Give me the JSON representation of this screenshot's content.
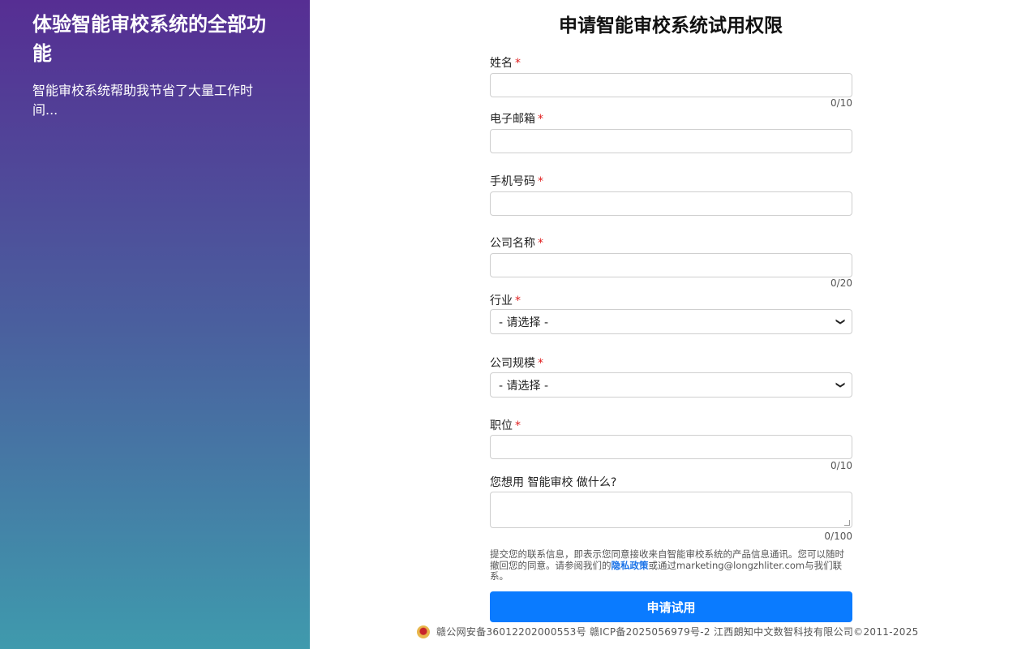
{
  "promo": {
    "title": "体验智能审校系统的全部功能",
    "subtitle": "智能审校系统帮助我节省了大量工作时间..."
  },
  "form": {
    "title": "申请智能审校系统试用权限",
    "required_mark": "*",
    "name": {
      "label": "姓名",
      "value": "",
      "counter": "0/10"
    },
    "email": {
      "label": "电子邮箱",
      "value": ""
    },
    "phone": {
      "label": "手机号码",
      "value": ""
    },
    "company": {
      "label": "公司名称",
      "value": "",
      "counter": "0/20"
    },
    "industry": {
      "label": "行业",
      "selected": "- 请选择 -"
    },
    "company_size": {
      "label": "公司规模",
      "selected": "- 请选择 -"
    },
    "position": {
      "label": "职位",
      "value": "",
      "counter": "0/10"
    },
    "purpose": {
      "label": "您想用 智能审校 做什么?",
      "value": "",
      "counter": "0/100"
    },
    "consent": {
      "before": "提交您的联系信息，即表示您同意接收来自智能审校系统的产品信息通讯。您可以随时撤回您的同意。请参阅我们的",
      "link": "隐私政策",
      "after": "或通过marketing@longzhliter.com与我们联系。"
    },
    "submit_label": "申请试用"
  },
  "footer": {
    "police_icon": "police-badge-icon",
    "text": "赣公网安备36012202000553号 赣ICP备2025056979号-2 江西朗知中文数智科技有限公司©2011-2025"
  },
  "colors": {
    "gradient_top": "#562e93",
    "gradient_bottom": "#3f9aad",
    "accent": "#0a7bff",
    "required": "#e02020"
  }
}
